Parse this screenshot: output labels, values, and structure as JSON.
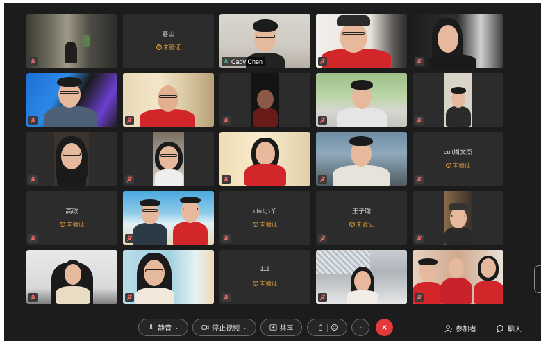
{
  "participants": [
    {
      "name": "",
      "type": "video"
    },
    {
      "name": "春山",
      "type": "name",
      "status": "未验证"
    },
    {
      "name": "Cady Chen",
      "type": "video"
    },
    {
      "name": "",
      "type": "video"
    },
    {
      "name": "",
      "type": "video"
    },
    {
      "name": "",
      "type": "video"
    },
    {
      "name": "",
      "type": "video"
    },
    {
      "name": "",
      "type": "video"
    },
    {
      "name": "",
      "type": "video"
    },
    {
      "name": "",
      "type": "video"
    },
    {
      "name": "",
      "type": "video"
    },
    {
      "name": "",
      "type": "video"
    },
    {
      "name": "",
      "type": "video"
    },
    {
      "name": "",
      "type": "video"
    },
    {
      "name": "cuit周文杰",
      "type": "name",
      "status": "未验证"
    },
    {
      "name": "高政",
      "type": "name",
      "status": "未验证"
    },
    {
      "name": "",
      "type": "video"
    },
    {
      "name": "cfrd小丫",
      "type": "name",
      "status": "未验证"
    },
    {
      "name": "王子瑜",
      "type": "name",
      "status": "未验证"
    },
    {
      "name": "",
      "type": "video"
    },
    {
      "name": "",
      "type": "video"
    },
    {
      "name": "",
      "type": "video"
    },
    {
      "name": "111",
      "type": "name",
      "status": "未验证"
    },
    {
      "name": "",
      "type": "video"
    },
    {
      "name": "",
      "type": "video"
    }
  ],
  "toolbar": {
    "mute_label": "静音",
    "stop_video_label": "停止视频",
    "share_label": "共享",
    "participants_label": "参加者",
    "chat_label": "聊天",
    "more_label": "···"
  },
  "colors": {
    "accent": "#3fc0ae",
    "warning": "#e2a13b",
    "end_call": "#e5383b"
  }
}
